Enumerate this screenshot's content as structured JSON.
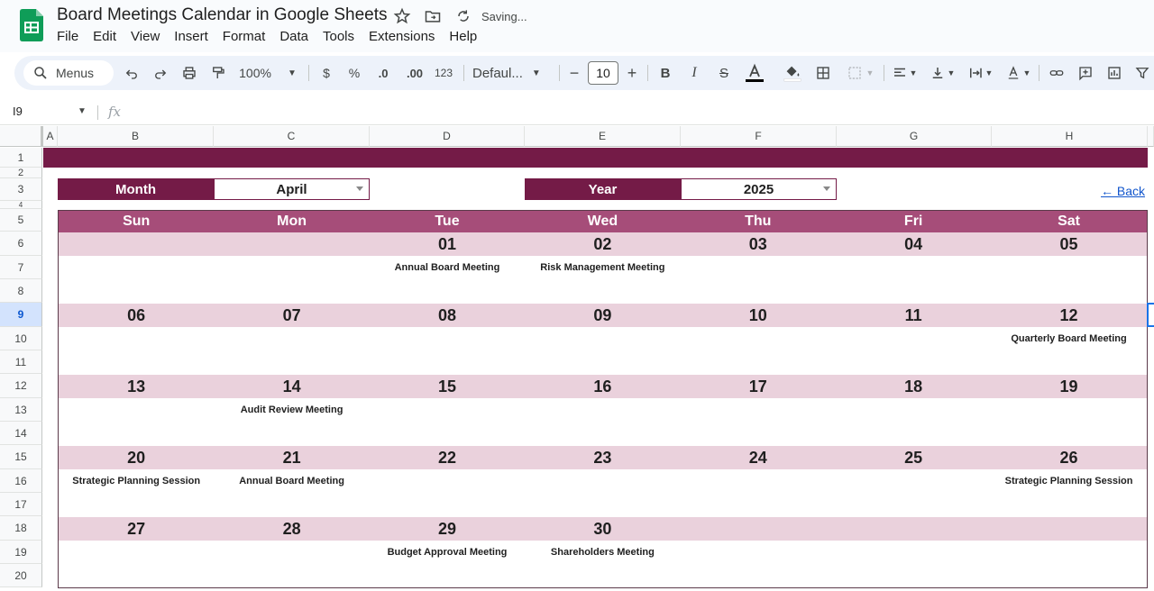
{
  "app": {
    "doc_title": "Board Meetings Calendar in Google Sheets",
    "saving_status": "Saving...",
    "menu": [
      "File",
      "Edit",
      "View",
      "Insert",
      "Format",
      "Data",
      "Tools",
      "Extensions",
      "Help"
    ]
  },
  "toolbar": {
    "search_label": "Menus",
    "zoom": "100%",
    "currency": "$",
    "percent": "%",
    "dec_decrease": ".0",
    "dec_increase": ".00",
    "number_format": "123",
    "font": "Defaul...",
    "font_size": "10"
  },
  "formula_bar": {
    "cell_ref": "I9",
    "fx": "fx"
  },
  "columns": [
    "A",
    "B",
    "C",
    "D",
    "E",
    "F",
    "G",
    "H"
  ],
  "rows": [
    "1",
    "2",
    "3",
    "4",
    "5",
    "6",
    "7",
    "8",
    "9",
    "10",
    "11",
    "12",
    "13",
    "14",
    "15",
    "16",
    "17",
    "18",
    "19",
    "20"
  ],
  "selected_row": "9",
  "selectors": {
    "month_label": "Month",
    "month_value": "April",
    "year_label": "Year",
    "year_value": "2025",
    "back_link": "← Back"
  },
  "calendar": {
    "days": [
      "Sun",
      "Mon",
      "Tue",
      "Wed",
      "Thu",
      "Fri",
      "Sat"
    ],
    "weeks": [
      {
        "dates": [
          "",
          "",
          "01",
          "02",
          "03",
          "04",
          "05"
        ],
        "events": [
          "",
          "",
          "Annual Board Meeting",
          "Risk Management Meeting",
          "",
          "",
          ""
        ]
      },
      {
        "dates": [
          "06",
          "07",
          "08",
          "09",
          "10",
          "11",
          "12"
        ],
        "events": [
          "",
          "",
          "",
          "",
          "",
          "",
          "Quarterly Board Meeting"
        ]
      },
      {
        "dates": [
          "13",
          "14",
          "15",
          "16",
          "17",
          "18",
          "19"
        ],
        "events": [
          "",
          "Audit Review Meeting",
          "",
          "",
          "",
          "",
          ""
        ]
      },
      {
        "dates": [
          "20",
          "21",
          "22",
          "23",
          "24",
          "25",
          "26"
        ],
        "events": [
          "Strategic Planning Session",
          "Annual Board Meeting",
          "",
          "",
          "",
          "",
          "Strategic Planning Session"
        ]
      },
      {
        "dates": [
          "27",
          "28",
          "29",
          "30",
          "",
          "",
          ""
        ],
        "events": [
          "",
          "",
          "Budget Approval Meeting",
          "Shareholders Meeting",
          "",
          "",
          ""
        ]
      }
    ]
  },
  "colors": {
    "title_band": "#741b47",
    "day_header": "#a64d79",
    "date_row": "#ead1dc",
    "sheets_green": "#0f9d58"
  }
}
